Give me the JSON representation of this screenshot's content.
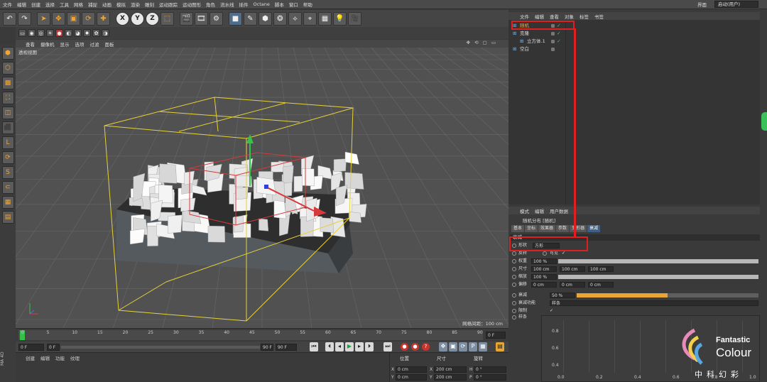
{
  "menubar": {
    "items": [
      "文件",
      "编辑",
      "创建",
      "选择",
      "工具",
      "网格",
      "捕捉",
      "动画",
      "模拟",
      "渲染",
      "雕刻",
      "运动跟踪",
      "运动图形",
      "角色",
      "流水线",
      "插件",
      "Octane",
      "脚本",
      "窗口",
      "帮助"
    ],
    "layout_label": "界面",
    "layout_value": "启动(用户)"
  },
  "toolbar": {
    "axis_x": "X",
    "axis_y": "Y",
    "axis_z": "Z"
  },
  "viewport": {
    "menu": [
      "查看",
      "摄像机",
      "显示",
      "选项",
      "过滤",
      "面板"
    ],
    "nav_icons": "✥ ⟲ ▢ ▭",
    "label": "透视视图",
    "grid_distance": "网格间距：100 cm",
    "colors": {
      "bg": "#515151",
      "grid": "#686868",
      "cage": "#e6d13a",
      "red_frame": "#d63a3a"
    }
  },
  "timeline": {
    "ticks": [
      "0",
      "5",
      "10",
      "15",
      "20",
      "25",
      "30",
      "35",
      "40",
      "45",
      "50",
      "55",
      "60",
      "65",
      "70",
      "75",
      "80",
      "85",
      "90"
    ],
    "end_field": "0 F"
  },
  "playbar": {
    "start": "0 F",
    "min": "0 F",
    "max": "90 F",
    "end": "90 F"
  },
  "material_manager": {
    "menu": [
      "创建",
      "编辑",
      "功能",
      "纹理"
    ]
  },
  "coordinates": {
    "headers": [
      "位置",
      "尺寸",
      "旋转"
    ],
    "rows": [
      {
        "axis": "X",
        "pos": "0 cm",
        "size_axis": "X",
        "size": "200 cm",
        "rot_axis": "H",
        "rot": "0 °"
      },
      {
        "axis": "Y",
        "pos": "0 cm",
        "size_axis": "Y",
        "size": "200 cm",
        "rot_axis": "P",
        "rot": "0 °"
      }
    ]
  },
  "object_manager": {
    "menu": [
      "文件",
      "编辑",
      "查看",
      "对象",
      "标签",
      "书签"
    ],
    "rows": [
      {
        "name": "随机",
        "flags": "✓",
        "indent": 0
      },
      {
        "name": "克隆",
        "flags": "✓",
        "indent": 0
      },
      {
        "name": "立方体.1",
        "flags": "✓",
        "indent": 1
      },
      {
        "name": "空白",
        "flags": "",
        "indent": 0
      }
    ]
  },
  "attribute_manager": {
    "menu": [
      "模式",
      "编辑",
      "用户数据"
    ],
    "title": "随机分布 [随机]",
    "tabs": [
      {
        "label": "基本",
        "active": false
      },
      {
        "label": "坐标",
        "active": false
      },
      {
        "label": "效果器",
        "active": false
      },
      {
        "label": "参数",
        "active": false
      },
      {
        "label": "变形器",
        "active": false
      },
      {
        "label": "衰减",
        "active": true
      }
    ],
    "section": "衰减",
    "shape_label": "形状",
    "shape_value": "方形",
    "invert_label": "反转",
    "visible_label": "可见",
    "visible_check": "✓",
    "weight_label": "权重",
    "weight_value": "100 %",
    "weight_fill": 1.0,
    "size_label": "尺寸",
    "size_values": [
      "100 cm",
      "100 cm",
      "100 cm"
    ],
    "scale_label": "缩放",
    "scale_value": "100 %",
    "scale_fill": 1.0,
    "offset_label": "偏移",
    "offset_values": [
      "0 cm",
      "0 cm",
      "0 cm"
    ],
    "falloff_label": "衰减",
    "falloff_value": "50 %",
    "falloff_fill": 0.5,
    "falloff_func_label": "衰减功能",
    "falloff_func_value": "样条",
    "limit_label": "限制",
    "limit_check": "✓",
    "spline_label": "样条",
    "graph_x_ticks": [
      "0.0",
      "0.2",
      "0.4",
      "0.6",
      "0.8",
      "1.0"
    ],
    "graph_y_ticks": [
      "0.8",
      "0.6",
      "0.4"
    ]
  },
  "logo": {
    "line1": "Fantastic",
    "line2": "Colour",
    "line3": "中科幻彩"
  },
  "vertical_label": "MA 4D"
}
